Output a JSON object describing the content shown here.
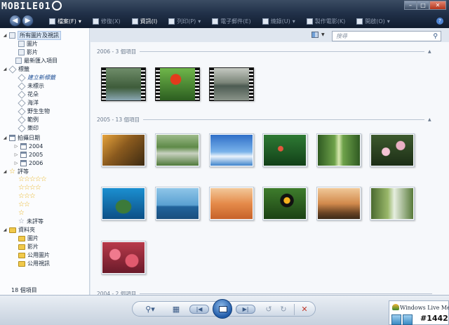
{
  "brand": {
    "logo_text": "MOBILE01"
  },
  "window_controls": {
    "minimize": "–",
    "maximize": "□",
    "close": "✕"
  },
  "menu": {
    "items": [
      {
        "label": "檔案(F)",
        "icon": "file-icon",
        "enabled": true,
        "dropdown": true
      },
      {
        "label": "修復(X)",
        "icon": "fix-icon",
        "enabled": false
      },
      {
        "label": "資訊(I)",
        "icon": "info-icon",
        "enabled": true
      },
      {
        "label": "列印(P)",
        "icon": "print-icon",
        "enabled": false,
        "dropdown": true
      },
      {
        "label": "電子郵件(E)",
        "icon": "email-icon",
        "enabled": false
      },
      {
        "label": "燒錄(U)",
        "icon": "burn-icon",
        "enabled": false,
        "dropdown": true
      },
      {
        "label": "製作電影(K)",
        "icon": "movie-icon",
        "enabled": false
      },
      {
        "label": "開啟(O)",
        "icon": "open-icon",
        "enabled": false,
        "dropdown": true
      }
    ]
  },
  "search": {
    "placeholder": "搜尋"
  },
  "nav": {
    "all_media": "所有圖片及視訊",
    "pictures": "圖片",
    "videos": "影片",
    "recently_imported": "最新匯入項目",
    "tags": "標籤",
    "create_tag": "建立新標籤",
    "untagged": "未標示",
    "tag_items": [
      "花朵",
      "海洋",
      "野生生物",
      "範例",
      "樂印"
    ],
    "date_taken": "拍攝日期",
    "years": [
      "2004",
      "2005",
      "2006"
    ],
    "ratings": "評等",
    "unrated": "未評等",
    "folders": "資料夾",
    "folder_items": [
      "圖片",
      "影片",
      "公用圖片",
      "公用視訊"
    ],
    "item_count": "18 個項目"
  },
  "groups": [
    {
      "label": "2006 - 3 個項目"
    },
    {
      "label": "2005 - 13 個項目"
    },
    {
      "label": "2004 - 2 個項目"
    }
  ],
  "messenger": {
    "title": "Windows Live Messen"
  },
  "watermark": "#1442",
  "colors": {
    "toolbar_dark": "#1b2a40",
    "accent_blue": "#1f5aa8",
    "pane_bg": "#f6f8fb"
  }
}
